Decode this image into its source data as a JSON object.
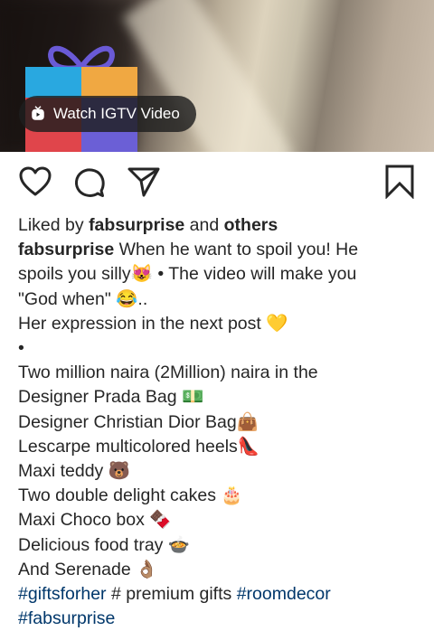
{
  "media": {
    "igtv_button_label": "Watch IGTV Video"
  },
  "icons": {
    "like": "heart-icon",
    "comment": "comment-icon",
    "share": "send-icon",
    "save": "bookmark-icon"
  },
  "likes": {
    "prefix": "Liked by ",
    "user": "fabsurprise",
    "and": " and ",
    "others": "others"
  },
  "caption": {
    "username": "fabsurprise",
    "line1_rest": " When he want to spoil you! He",
    "line2": "spoils you silly😻 • The video will make you",
    "line3": "\"God when\" 😂..",
    "line4": "Her expression in the next post 💛",
    "line5": "•",
    "line6": "Two million naira (2Million) naira in the",
    "line7": "Designer Prada Bag 💵",
    "line8": "Designer Christian Dior Bag👜",
    "line9": "Lescarpe multicolored heels👠",
    "line10": "Maxi teddy 🐻",
    "line11": "Two double delight cakes 🎂",
    "line12": "Maxi Choco box 🍫",
    "line13": "Delicious food tray 🍲",
    "line14": "And Serenade 👌🏽",
    "hashtag1": "#giftsforher",
    "plain_tag": " # premium gifts ",
    "hashtag2": "#roomdecor",
    "hashtag3": "#fabsurprise"
  },
  "colors": {
    "hashtag": "#00376b",
    "text": "#262626",
    "pill_bg": "#1e1e1e"
  }
}
